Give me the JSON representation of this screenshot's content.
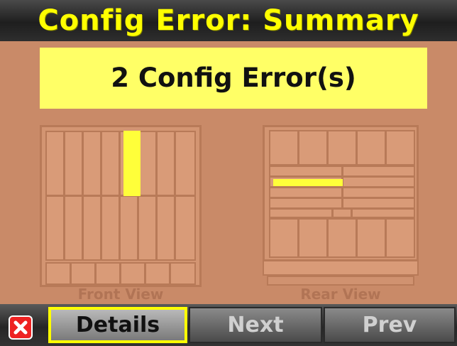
{
  "title": "Config Error: Summary",
  "error_summary": "2 Config Error(s)",
  "front_view": {
    "label": "Front View"
  },
  "rear_view": {
    "label": "Rear View"
  },
  "softkeys": {
    "close_icon": "close-x-icon",
    "details": "Details",
    "next": "Next",
    "prev": "Prev"
  },
  "colors": {
    "background": "#c98a68",
    "highlight": "#ffff00",
    "error_box": "#ffff66",
    "title_text": "#ffff00"
  }
}
